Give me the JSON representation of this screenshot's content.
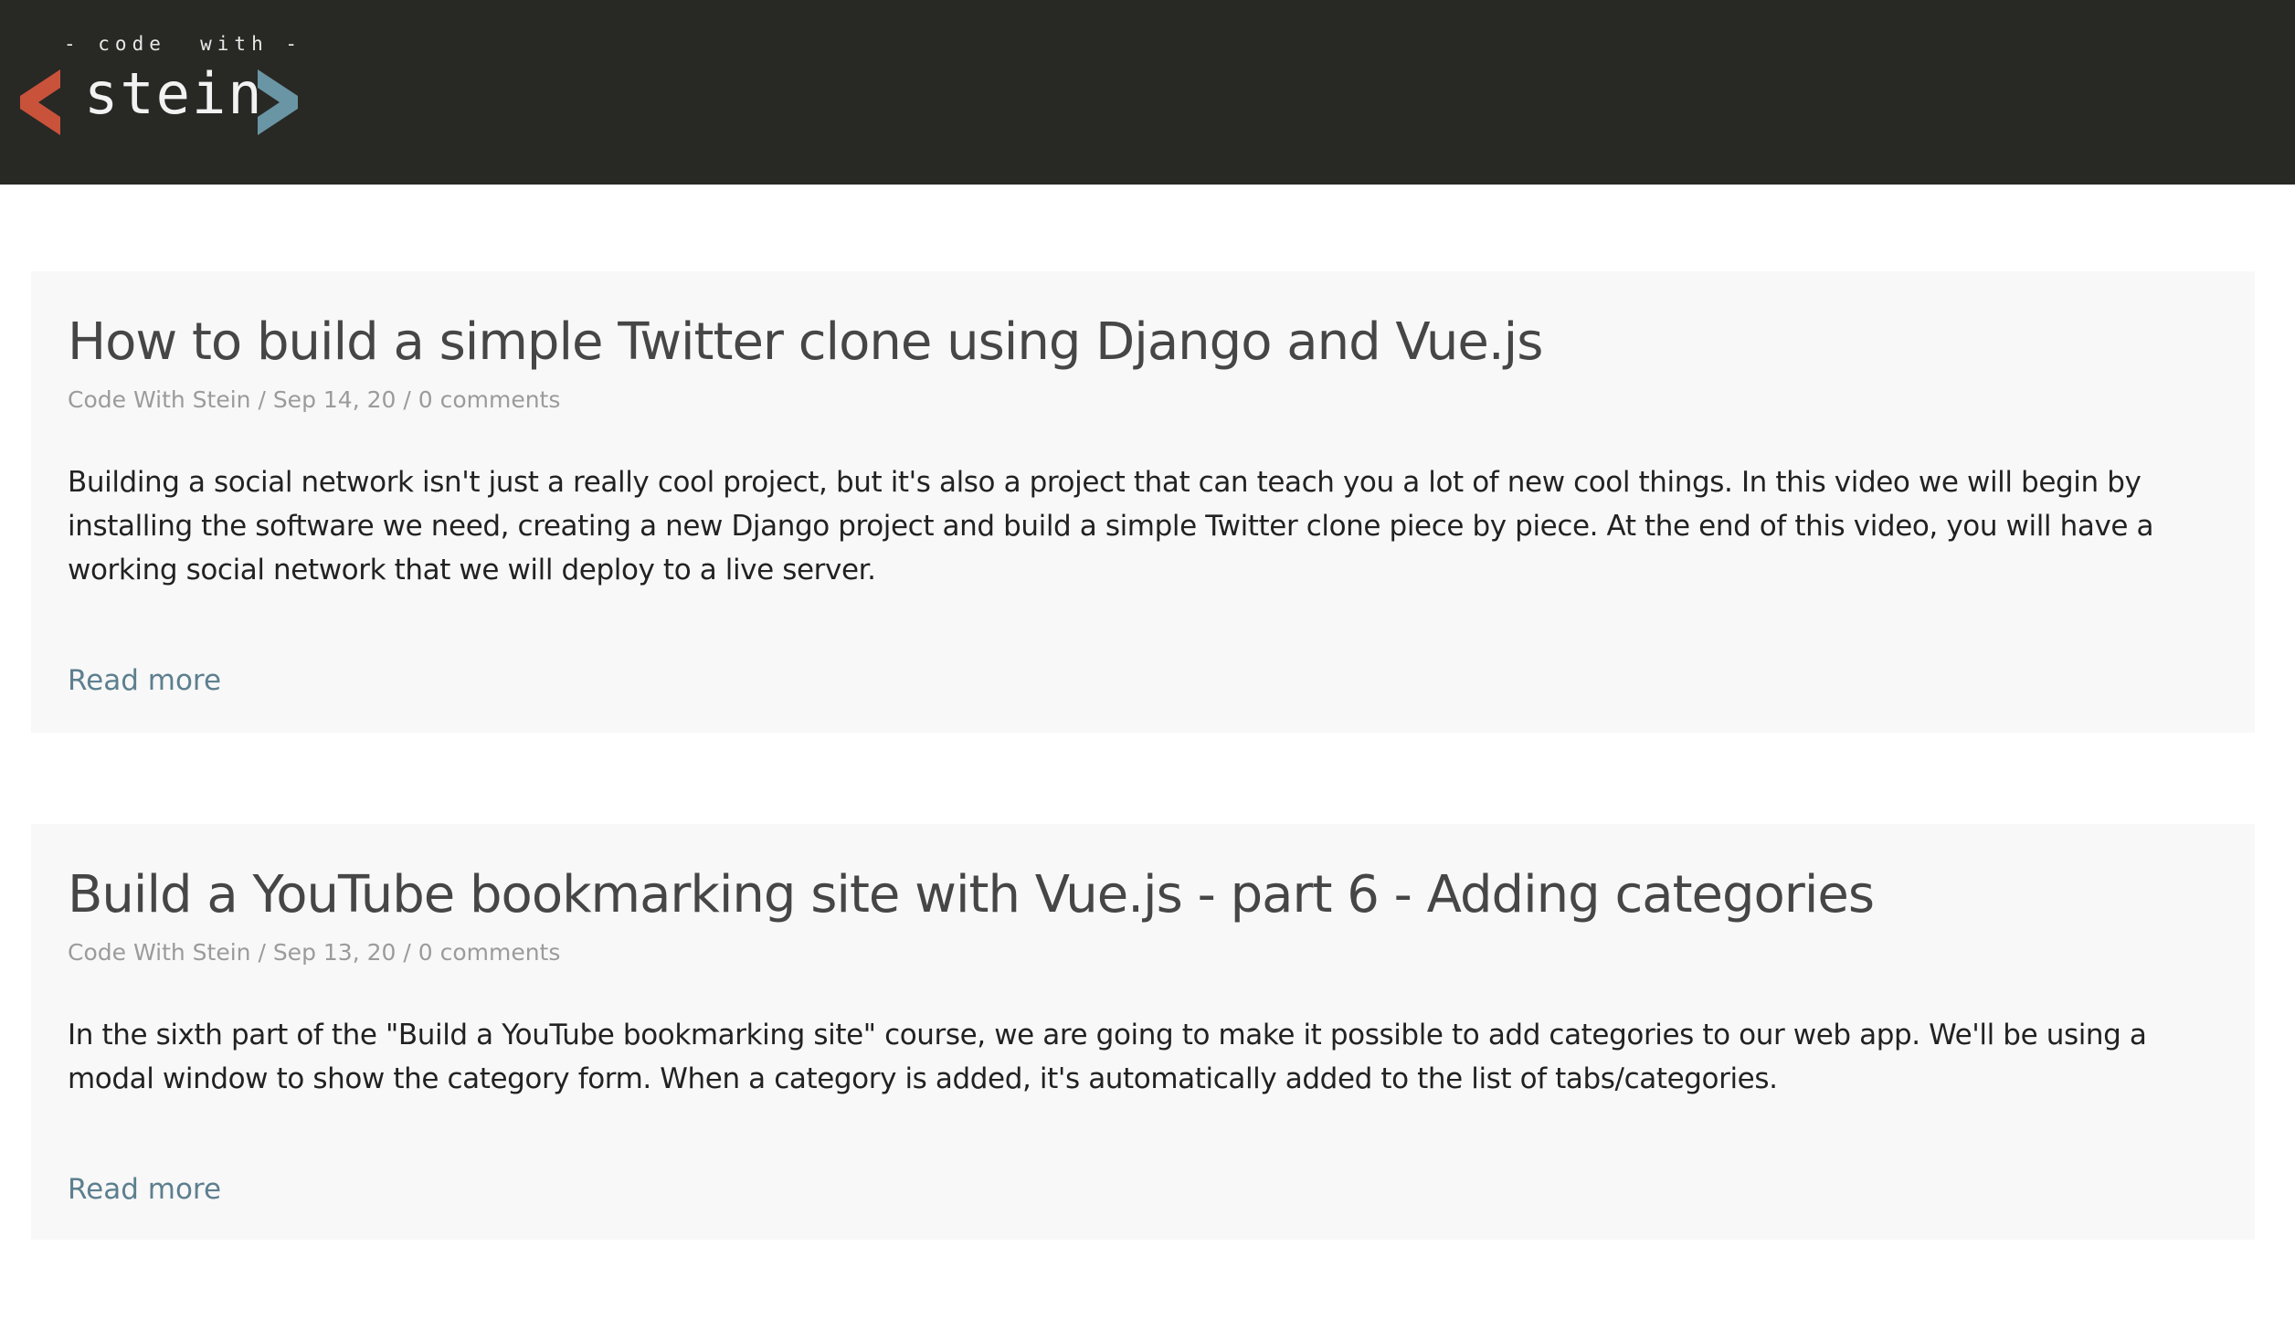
{
  "header": {
    "logo": {
      "tagline": "- code  with -",
      "name": "stein",
      "left_chevron_color": "#c9523b",
      "right_chevron_color": "#6a95a4"
    },
    "background_color": "#282825"
  },
  "posts": [
    {
      "title": "How to build a simple Twitter clone using Django and Vue.js",
      "meta": "Code With Stein / Sep 14, 20 / 0 comments",
      "excerpt": "Building a social network isn't just a really cool project, but it's also a project that can teach you a lot of new cool things. In this video we will begin by installing the software we need, creating a new Django project and build a simple Twitter clone piece by piece. At the end of this video, you will have a working social network that we will deploy to a live server.",
      "read_more_label": "Read more"
    },
    {
      "title": "Build a YouTube bookmarking site with Vue.js - part 6 - Adding categories",
      "meta": "Code With Stein / Sep 13, 20 / 0 comments",
      "excerpt": "In the sixth part of the \"Build a YouTube bookmarking site\" course, we are going to make it possible to add categories to our web app. We'll be using a modal window to show the category form. When a category is added, it's automatically added to the list of tabs/categories.",
      "read_more_label": "Read more"
    }
  ],
  "colors": {
    "link": "#5d7f8f",
    "card_background": "#f8f8f8",
    "title": "#464646",
    "meta": "#9b9b9b"
  }
}
